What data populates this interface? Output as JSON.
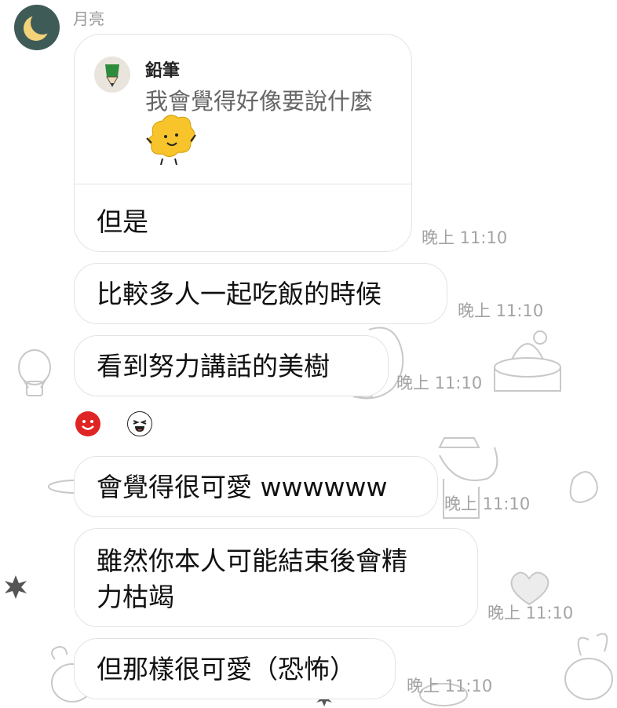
{
  "sender": {
    "name": "月亮"
  },
  "reply": {
    "quoted_author": "鉛筆",
    "quoted_text": "我會覺得好像要說什麼",
    "quoted_sticker": "yellow-blob-sticker",
    "message": "但是",
    "time": "晚上 11:10"
  },
  "messages": [
    {
      "text": "比較多人一起吃飯的時候",
      "time": "晚上 11:10"
    },
    {
      "text": "看到努力講話的美樹",
      "time": "晚上 11:10"
    },
    {
      "text": "會覺得很可愛 wwwwww",
      "time": "晚上 11:10"
    },
    {
      "text_line1": "雖然你本人可能結束後會精",
      "text_line2": "力枯竭",
      "time": "晚上 11:10"
    },
    {
      "text": "但那樣很可愛（恐怖）",
      "time": "晚上 11:10"
    }
  ],
  "reactions": [
    {
      "icon": "red-smile-icon",
      "color": "#e02424"
    },
    {
      "icon": "laughing-face-icon",
      "color": "#ffffff"
    }
  ],
  "colors": {
    "avatar_bg": "#3f5b58",
    "moon": "#f3d27a",
    "bubble_border": "#e3e3e3",
    "time_text": "#a3a3a3"
  }
}
